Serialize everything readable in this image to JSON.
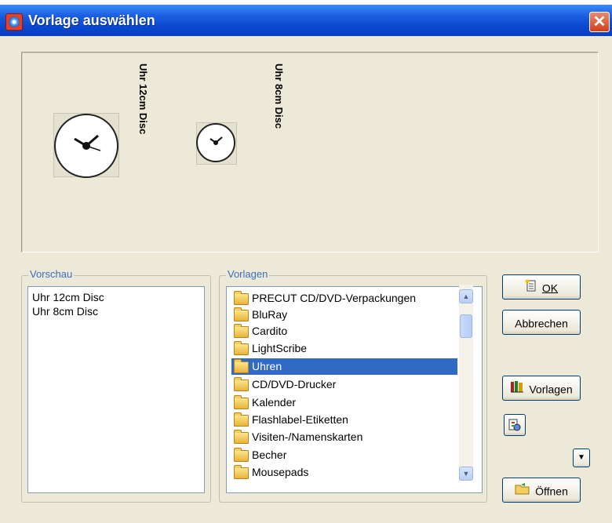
{
  "window": {
    "title": "Vorlage auswählen",
    "close_glyph": "✕"
  },
  "preview": {
    "templates": [
      {
        "label": "Uhr 12cm Disc",
        "icon": "clock-icon"
      },
      {
        "label": "Uhr 8cm Disc",
        "icon": "clock-icon"
      }
    ]
  },
  "vorschau": {
    "legend": "Vorschau",
    "items": [
      "Uhr 12cm Disc",
      "Uhr 8cm Disc"
    ]
  },
  "vorlagen": {
    "legend": "Vorlagen",
    "selected": "Uhren",
    "items": [
      "PRECUT CD/DVD-Verpackungen",
      "BluRay",
      "Cardito",
      "LightScribe",
      "Uhren",
      "CD/DVD-Drucker",
      "Kalender",
      "Flashlabel-Etiketten",
      "Visiten-/Namenskarten",
      "Becher",
      "Mousepads"
    ],
    "scroll_up": "▲",
    "scroll_down": "▼"
  },
  "buttons": {
    "ok_label": "OK",
    "cancel_label": "Abbrechen",
    "templates_label": "Vorlagen",
    "dropdown_glyph": "▼",
    "open_label": "Öffnen"
  },
  "colors": {
    "titlebar": "#0a47d0",
    "selection": "#316ac5",
    "legend_text": "#3a6ec0",
    "window_bg": "#ece9d8"
  }
}
